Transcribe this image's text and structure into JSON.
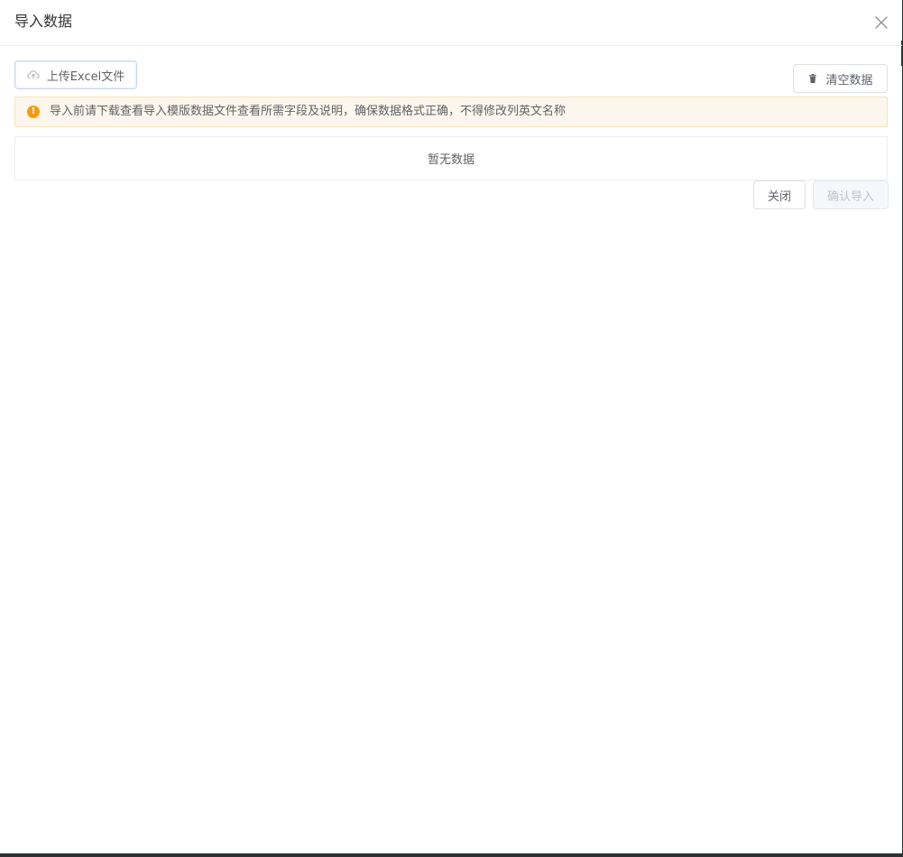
{
  "dialog": {
    "title": "导入数据"
  },
  "toolbar": {
    "upload_label": "上传Excel文件",
    "clear_label": "清空数据"
  },
  "alert": {
    "message": "导入前请下载查看导入模版数据文件查看所需字段及说明，确保数据格式正确，不得修改列英文名称",
    "icon_symbol": "!",
    "color": "#f39c12"
  },
  "table": {
    "empty_text": "暂无数据"
  },
  "footer": {
    "close_label": "关闭",
    "confirm_label": "确认导入"
  }
}
